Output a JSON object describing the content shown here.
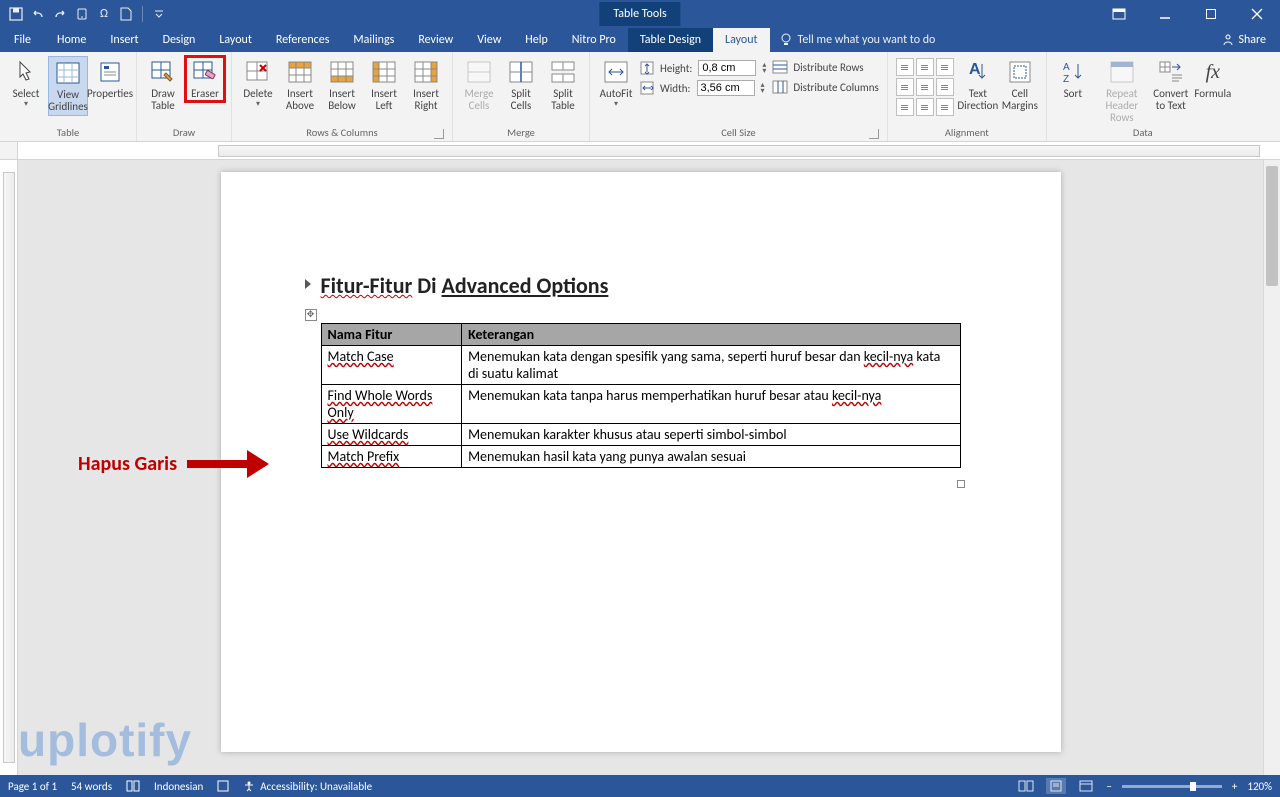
{
  "titlebar": {
    "contextual_label": "Table Tools"
  },
  "window": {
    "min_tip": "Minimize",
    "max_tip": "Maximize",
    "close_tip": "Close",
    "ribbon_opts": "Ribbon Display Options"
  },
  "tabs": {
    "file": "File",
    "home": "Home",
    "insert": "Insert",
    "design": "Design",
    "layout": "Layout",
    "references": "References",
    "mailings": "Mailings",
    "review": "Review",
    "view": "View",
    "help": "Help",
    "nitro": "Nitro Pro",
    "tbl_design": "Table Design",
    "tbl_layout": "Layout",
    "tellme": "Tell me what you want to do",
    "share": "Share"
  },
  "ribbon": {
    "table_group": "Table",
    "draw_group": "Draw",
    "rows_cols_group": "Rows & Columns",
    "merge_group": "Merge",
    "cellsize_group": "Cell Size",
    "alignment_group": "Alignment",
    "data_group": "Data",
    "select": "Select",
    "view_gridlines": "View\nGridlines",
    "properties": "Properties",
    "draw_table": "Draw\nTable",
    "eraser": "Eraser",
    "delete": "Delete",
    "insert_above": "Insert\nAbove",
    "insert_below": "Insert\nBelow",
    "insert_left": "Insert\nLeft",
    "insert_right": "Insert\nRight",
    "merge_cells": "Merge\nCells",
    "split_cells": "Split\nCells",
    "split_table": "Split\nTable",
    "autofit": "AutoFit",
    "height_lbl": "Height:",
    "width_lbl": "Width:",
    "height_val": "0,8 cm",
    "width_val": "3,56 cm",
    "dist_rows": "Distribute Rows",
    "dist_cols": "Distribute Columns",
    "text_dir": "Text\nDirection",
    "cell_margins": "Cell\nMargins",
    "sort": "Sort",
    "repeat_header": "Repeat\nHeader Rows",
    "convert": "Convert\nto Text",
    "formula": "Formula"
  },
  "document": {
    "heading_prefix": "Fitur-Fitur",
    "heading_mid": " Di ",
    "heading_suffix": "Advanced Options",
    "col1": "Nama Fitur",
    "col2": "Keterangan",
    "rows": [
      {
        "name": "Match Case",
        "desc_a": "Menemukan kata dengan spesifik yang sama, seperti huruf besar dan ",
        "desc_u": "kecil-nya",
        "desc_b": " kata di suatu kalimat"
      },
      {
        "name": "Find Whole Words Only",
        "desc_a": "Menemukan kata tanpa harus memperhatikan huruf besar atau ",
        "desc_u": "kecil-nya",
        "desc_b": ""
      },
      {
        "name": "Use Wildcards",
        "desc_a": "Menemukan karakter khusus atau seperti simbol-simbol",
        "desc_u": "",
        "desc_b": ""
      },
      {
        "name": "Match Prefix",
        "desc_a": "Menemukan hasil kata yang punya awalan sesuai",
        "desc_u": "",
        "desc_b": ""
      }
    ]
  },
  "annotation": {
    "label": "Hapus Garis"
  },
  "watermark": "uplotify",
  "status": {
    "page": "Page 1 of 1",
    "words": "54 words",
    "lang": "Indonesian",
    "access": "Accessibility: Unavailable",
    "zoom": "120%"
  }
}
